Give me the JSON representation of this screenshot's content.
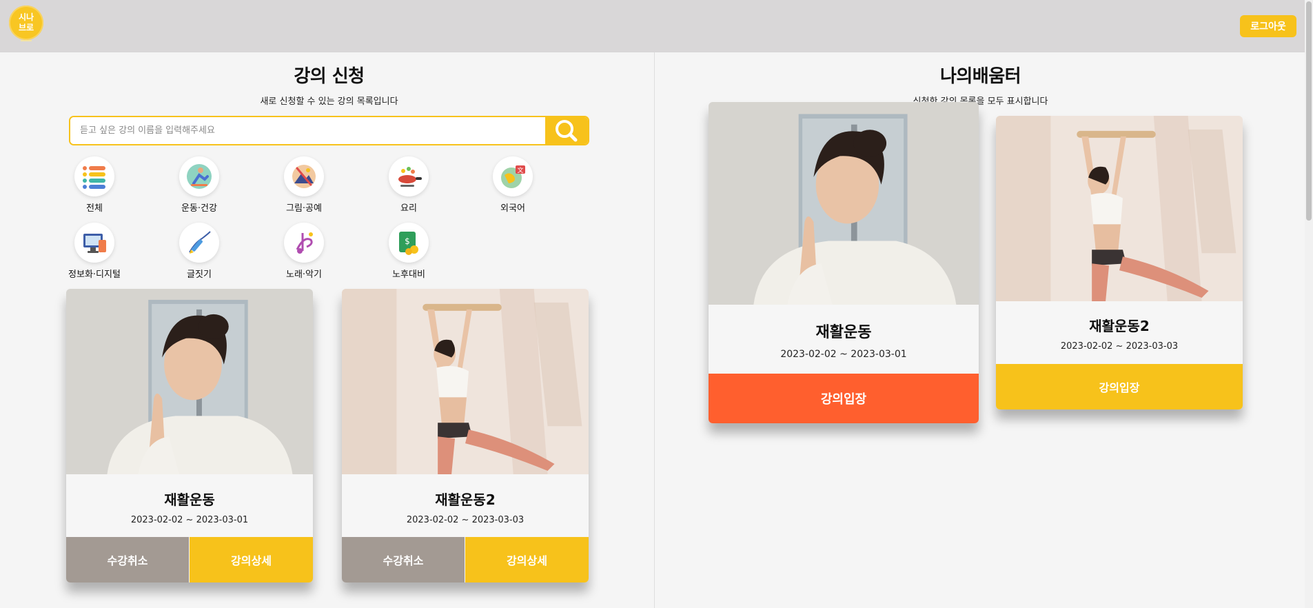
{
  "header": {
    "logo_text": "시나\n브로",
    "logout_label": "로그아웃",
    "brand_color": "#f7c21b"
  },
  "enroll": {
    "title": "강의 신청",
    "subtitle": "새로 신청할 수 있는 강의 목록입니다",
    "search": {
      "placeholder": "듣고 싶은 강의 이름을 입력해주세요",
      "value": ""
    },
    "categories": [
      {
        "label": "전체",
        "icon": "list-icon"
      },
      {
        "label": "운동·건강",
        "icon": "exercise-icon"
      },
      {
        "label": "그림·공예",
        "icon": "art-icon"
      },
      {
        "label": "요리",
        "icon": "cooking-icon"
      },
      {
        "label": "외국어",
        "icon": "language-icon"
      },
      {
        "label": "정보화·디지털",
        "icon": "computer-icon"
      },
      {
        "label": "글짓기",
        "icon": "writing-icon"
      },
      {
        "label": "노래·악기",
        "icon": "music-icon"
      },
      {
        "label": "노후대비",
        "icon": "money-icon"
      }
    ],
    "courses": [
      {
        "title": "재활운동",
        "period": "2023-02-02 ~ 2023-03-01",
        "cancel_label": "수강취소",
        "detail_label": "강의상세"
      },
      {
        "title": "재활운동2",
        "period": "2023-02-02 ~ 2023-03-03",
        "cancel_label": "수강취소",
        "detail_label": "강의상세"
      }
    ]
  },
  "my_learning": {
    "title": "나의배움터",
    "subtitle": "신청한 강의 목록을 모두 표시합니다",
    "courses": [
      {
        "title": "재활운동",
        "period": "2023-02-02 ~ 2023-03-01",
        "enter_label": "강의입장",
        "button_color": "#ff5f2e"
      },
      {
        "title": "재활운동2",
        "period": "2023-02-02 ~ 2023-03-03",
        "enter_label": "강의입장",
        "button_color": "#f7c21b"
      }
    ]
  }
}
